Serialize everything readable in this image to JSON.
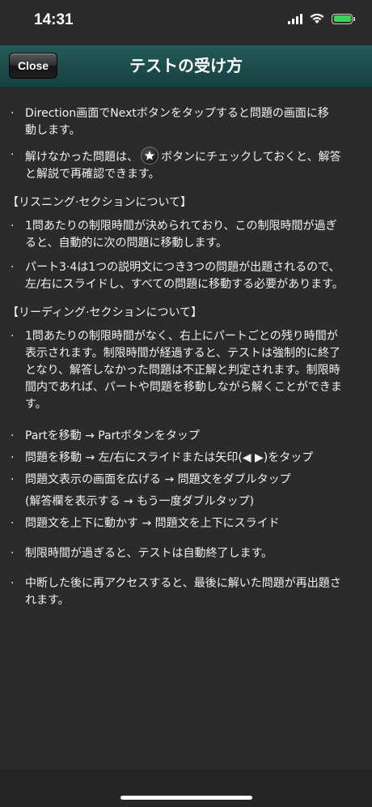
{
  "status": {
    "time": "14:31"
  },
  "nav": {
    "close_label": "Close",
    "title": "テストの受け方"
  },
  "intro": [
    {
      "line1": "Direction画面でNextボタンをタップすると問題の画面に移",
      "line2": "動します。"
    },
    {
      "pre": "解けなかった問題は、",
      "post": "ボタンにチェックしておくと、解答",
      "line2": "と解説で再確認できます。"
    }
  ],
  "listening": {
    "heading": "【リスニング·セクションについて】",
    "items": [
      {
        "line1": "1問あたりの制限時間が決められており、この制限時間が過ぎ",
        "line2": "ると、自動的に次の問題に移動します。"
      },
      {
        "line1": "パート3·4は1つの説明文につき3つの問題が出題されるので、",
        "line2": "左/右にスライドし、すべての問題に移動する必要があります。"
      }
    ]
  },
  "reading": {
    "heading": "【リーディング·セクションについて】",
    "item": {
      "line1": "1問あたりの制限時間がなく、右上にパートごとの残り時間が",
      "line2": "表示されます。制限時間が経過すると、テストは強制的に終了",
      "line3": "となり、解答しなかった問題は不正解と判定されます。制限時",
      "line4": "間内であれば、パートや問題を移動しながら解くことができま",
      "line5": "す。"
    }
  },
  "operations": [
    "Partを移動 → Partボタンをタップ",
    "問題を移動 → 左/右にスライドまたは矢印(◀ ▶)をタップ",
    "問題文表示の画面を広げる → 問題文をダブルタップ"
  ],
  "operations_sub": "(解答欄を表示する → もう一度ダブルタップ)",
  "operation_last": "問題文を上下に動かす → 問題文を上下にスライド",
  "notes": [
    {
      "line1": "制限時間が過ぎると、テストは自動終了します。"
    },
    {
      "line1": "中断した後に再アクセスすると、最後に解いた問題が再出題さ",
      "line2": "れます。"
    }
  ]
}
